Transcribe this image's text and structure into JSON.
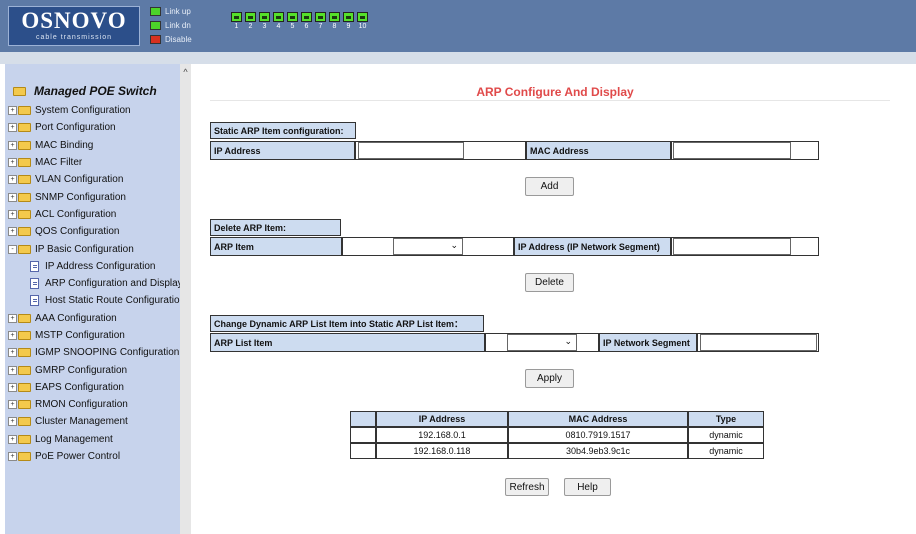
{
  "header": {
    "logo_main": "OSNOVO",
    "logo_sub": "cable transmission",
    "legend": [
      {
        "label": "Link up",
        "color": "#4cd32a"
      },
      {
        "label": "Link dn",
        "color": "#4cd32a"
      },
      {
        "label": "Disable",
        "color": "#d8301e"
      }
    ],
    "ports": [
      "1",
      "2",
      "3",
      "4",
      "5",
      "6",
      "7",
      "8",
      "9",
      "10"
    ]
  },
  "sidebar": {
    "title": "Managed POE Switch",
    "scroll_up": "^",
    "items": [
      {
        "label": "System Configuration",
        "level": 0,
        "expander": "+"
      },
      {
        "label": "Port Configuration",
        "level": 0,
        "expander": "+"
      },
      {
        "label": "MAC Binding",
        "level": 0,
        "expander": "+"
      },
      {
        "label": "MAC Filter",
        "level": 0,
        "expander": "+"
      },
      {
        "label": "VLAN Configuration",
        "level": 0,
        "expander": "+"
      },
      {
        "label": "SNMP Configuration",
        "level": 0,
        "expander": "+"
      },
      {
        "label": "ACL Configuration",
        "level": 0,
        "expander": "+"
      },
      {
        "label": "QOS Configuration",
        "level": 0,
        "expander": "+"
      },
      {
        "label": "IP Basic Configuration",
        "level": 0,
        "expander": "-"
      },
      {
        "label": "IP Address Configuration",
        "level": 1,
        "expander": ""
      },
      {
        "label": "ARP Configuration and Display",
        "level": 1,
        "expander": ""
      },
      {
        "label": "Host Static Route Configuration",
        "level": 1,
        "expander": ""
      },
      {
        "label": "AAA Configuration",
        "level": 0,
        "expander": "+"
      },
      {
        "label": "MSTP Configuration",
        "level": 0,
        "expander": "+"
      },
      {
        "label": "IGMP SNOOPING Configuration",
        "level": 0,
        "expander": "+"
      },
      {
        "label": "GMRP Configuration",
        "level": 0,
        "expander": "+"
      },
      {
        "label": "EAPS Configuration",
        "level": 0,
        "expander": "+"
      },
      {
        "label": "RMON Configuration",
        "level": 0,
        "expander": "+"
      },
      {
        "label": "Cluster Management",
        "level": 0,
        "expander": "+"
      },
      {
        "label": "Log Management",
        "level": 0,
        "expander": "+"
      },
      {
        "label": "PoE Power Control",
        "level": 0,
        "expander": "+"
      }
    ]
  },
  "main": {
    "title": "ARP Configure And Display",
    "static_section": {
      "heading": "Static ARP Item configuration:",
      "ip_label": "IP Address",
      "ip_value": "",
      "mac_label": "MAC Address",
      "mac_value": "",
      "add_button": "Add"
    },
    "delete_section": {
      "heading": "Delete ARP Item:",
      "arp_item_label": "ARP Item",
      "arp_item_value": "",
      "ip_segment_label": "IP Address (IP Network Segment)",
      "ip_segment_value": "",
      "delete_button": "Delete"
    },
    "change_section": {
      "heading": "Change Dynamic ARP List Item into Static ARP List Item：",
      "list_item_label": "ARP List Item",
      "list_item_value": "",
      "segment_label": "IP Network Segment",
      "segment_value": "",
      "apply_button": "Apply"
    },
    "table": {
      "headers": [
        "",
        "IP Address",
        "MAC Address",
        "Type"
      ],
      "rows": [
        {
          "ip": "192.168.0.1",
          "mac": "0810.7919.1517",
          "type": "dynamic"
        },
        {
          "ip": "192.168.0.118",
          "mac": "30b4.9eb3.9c1c",
          "type": "dynamic"
        }
      ]
    },
    "refresh_button": "Refresh",
    "help_button": "Help"
  }
}
